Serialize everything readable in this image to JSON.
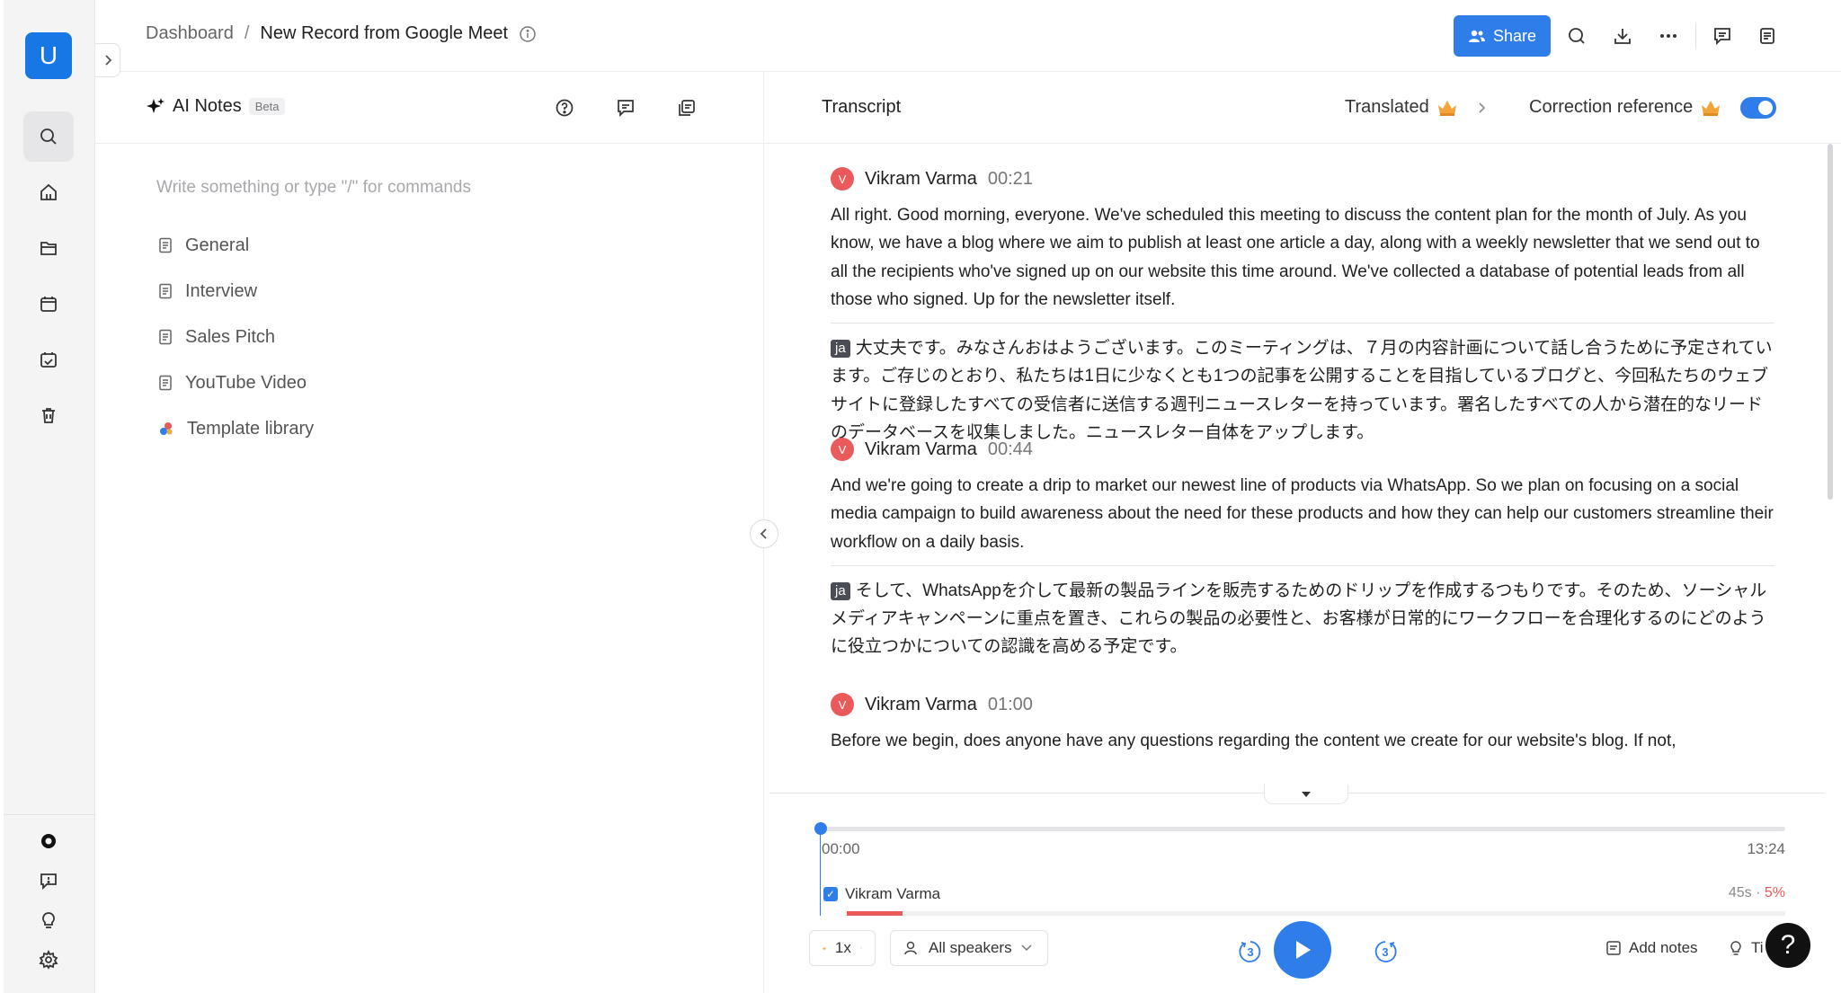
{
  "user": {
    "initial": "U"
  },
  "breadcrumb": {
    "root": "Dashboard",
    "separator": "/",
    "current": "New Record from Google Meet"
  },
  "toolbar": {
    "share_label": "Share"
  },
  "notes": {
    "title": "AI Notes",
    "badge": "Beta",
    "placeholder": "Write something or type \"/\" for commands",
    "templates": [
      "General",
      "Interview",
      "Sales Pitch",
      "YouTube Video"
    ],
    "library_label": "Template library"
  },
  "transcript": {
    "title": "Transcript",
    "translated_label": "Translated",
    "correction_label": "Correction reference",
    "language_tag": "ja",
    "segments": [
      {
        "speaker_initial": "V",
        "speaker": "Vikram Varma",
        "time": "00:21",
        "text": "All right. Good morning, everyone. We've scheduled this meeting to discuss the content plan for the month of July. As you know, we have a blog where we aim to publish at least one article a day, along with a weekly newsletter that we send out to all the recipients who've signed up on our website this time around. We've collected a database of potential leads from all those who signed. Up for the newsletter itself.",
        "translation": "大丈夫です。みなさんおはようございます。このミーティングは、７月の内容計画について話し合うために予定されています。ご存じのとおり、私たちは1日に少なくとも1つの記事を公開することを目指しているブログと、今回私たちのウェブサイトに登録したすべての受信者に送信する週刊ニュースレターを持っています。署名したすべての人から潜在的なリードのデータベースを収集しました。ニュースレター自体をアップします。"
      },
      {
        "speaker_initial": "V",
        "speaker": "Vikram Varma",
        "time": "00:44",
        "text": "And we're going to create a drip to market our newest line of products via WhatsApp. So we plan on focusing on a social media campaign to build awareness about the need for these products and how they can help our customers streamline their workflow on a daily basis.",
        "translation": "そして、WhatsAppを介して最新の製品ラインを販売するためのドリップを作成するつもりです。そのため、ソーシャルメディアキャンペーンに重点を置き、これらの製品の必要性と、お客様が日常的にワークフローを合理化するのにどのように役立つかについての認識を高める予定です。"
      },
      {
        "speaker_initial": "V",
        "speaker": "Vikram Varma",
        "time": "01:00",
        "text": "Before we begin, does anyone have any questions regarding the content we create for our website's blog. If not,"
      }
    ]
  },
  "player": {
    "current_time": "00:00",
    "duration": "13:24",
    "progress": 0,
    "speaker": "Vikram Varma",
    "speaker_duration": "45s",
    "speaker_dot": "·",
    "speaker_percent": "5%",
    "speed": "1x",
    "speakers_filter": "All speakers",
    "skip_seconds": "3",
    "add_notes_label": "Add notes",
    "tips_label": "Ti"
  },
  "help_label": "?",
  "colors": {
    "accent": "#2f7de9",
    "speaker_dot": "#ea5a5a",
    "avatar": "#1677e5"
  }
}
